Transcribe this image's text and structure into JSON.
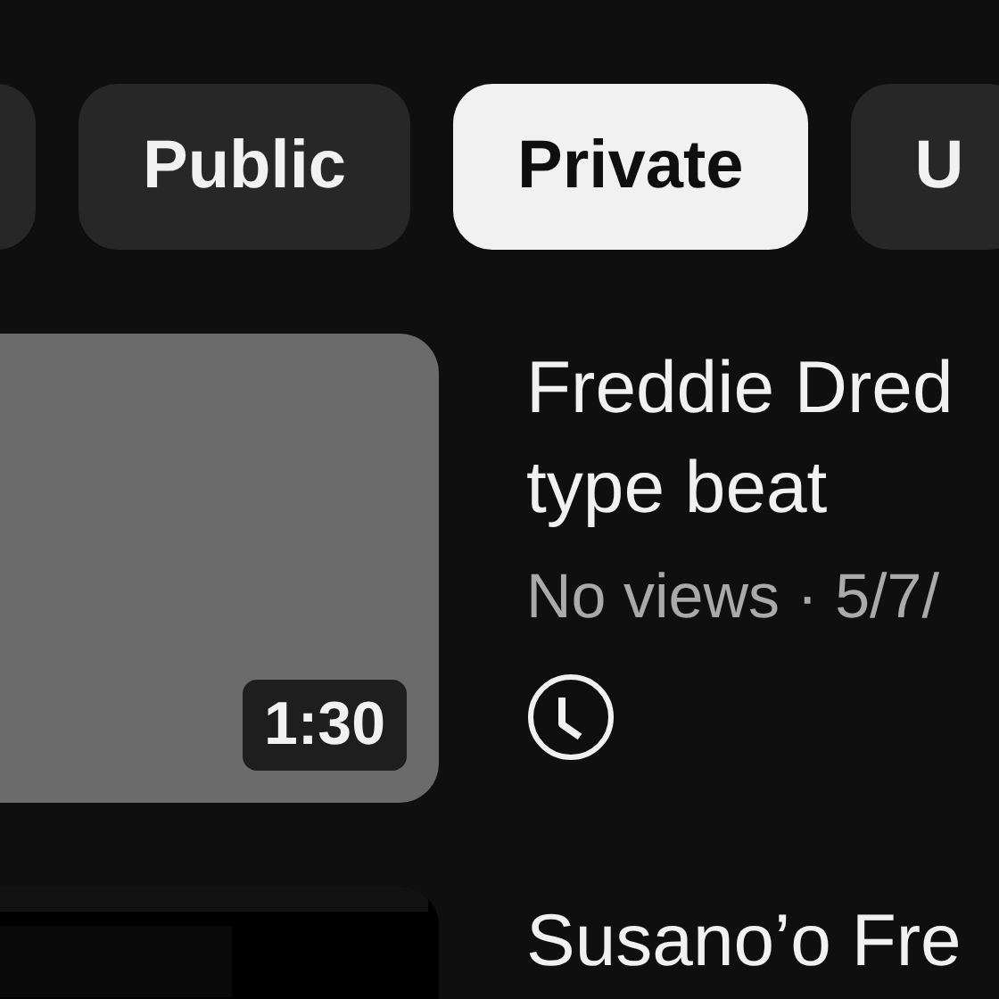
{
  "chips": [
    {
      "selected": false
    },
    {
      "label": "Public",
      "selected": false
    },
    {
      "label": "Private",
      "selected": true
    },
    {
      "label": "U",
      "selected": false
    }
  ],
  "videos": [
    {
      "kind": "plain",
      "duration": "1:30",
      "title": "Freddie Dred type beat",
      "meta": "No views · 5/7/",
      "scheduled": true
    },
    {
      "kind": "picture",
      "title": "Susano’o Fre"
    }
  ]
}
